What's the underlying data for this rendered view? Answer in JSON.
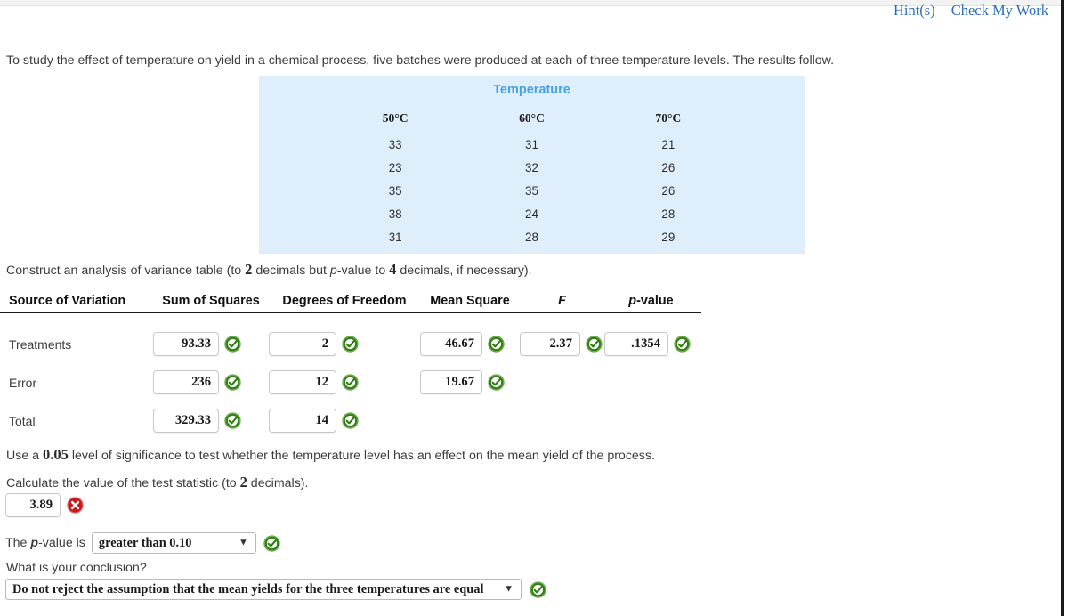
{
  "header": {
    "hint_label": "Hint(s)",
    "check_label": "Check My Work"
  },
  "intro": {
    "text_before": "To study the effect of temperature on yield in a chemical process, five batches were produced at each of three temperature levels. The results follow."
  },
  "data_table": {
    "title": "Temperature",
    "columns": [
      "50°C",
      "60°C",
      "70°C"
    ],
    "rows": [
      [
        "33",
        "31",
        "21"
      ],
      [
        "23",
        "32",
        "26"
      ],
      [
        "35",
        "35",
        "26"
      ],
      [
        "38",
        "24",
        "28"
      ],
      [
        "31",
        "28",
        "29"
      ]
    ]
  },
  "construct_prompt": {
    "part1": "Construct an analysis of variance table (to ",
    "decimals1": "2",
    "part2": " decimals but ",
    "pital": "p",
    "part3": "-value to ",
    "decimals2": "4",
    "part4": " decimals, if necessary)."
  },
  "anova": {
    "headers": {
      "source": "Source of Variation",
      "ss": "Sum of Squares",
      "df": "Degrees of Freedom",
      "ms": "Mean Square",
      "f": "F",
      "p_italic": "p",
      "p_rest": "-value"
    },
    "rows": [
      {
        "label": "Treatments",
        "ss": "93.33",
        "ss_mark": "correct",
        "df": "2",
        "df_mark": "correct",
        "ms": "46.67",
        "ms_mark": "correct",
        "f": "2.37",
        "f_mark": "correct",
        "p": ".1354",
        "p_mark": "correct"
      },
      {
        "label": "Error",
        "ss": "236",
        "ss_mark": "correct",
        "df": "12",
        "df_mark": "correct",
        "ms": "19.67",
        "ms_mark": "correct",
        "f": "",
        "f_mark": "none",
        "p": "",
        "p_mark": "none"
      },
      {
        "label": "Total",
        "ss": "329.33",
        "ss_mark": "correct",
        "df": "14",
        "df_mark": "correct",
        "ms": "",
        "ms_mark": "none",
        "f": "",
        "f_mark": "none",
        "p": "",
        "p_mark": "none"
      }
    ]
  },
  "significance": {
    "part1": "Use a ",
    "level": "0.05",
    "part2": " level of significance to test whether the temperature level has an effect on the mean yield of the process."
  },
  "teststat_prompt": {
    "part1": "Calculate the value of the test statistic (to ",
    "decimals": "2",
    "part2": " decimals)."
  },
  "teststat": {
    "value": "3.89",
    "mark": "incorrect"
  },
  "pvalue": {
    "label_before": "The ",
    "label_italic": "p",
    "label_after": "-value is",
    "selected": "greater than 0.10",
    "options": [
      "greater than 0.10"
    ],
    "mark": "correct"
  },
  "conclusion": {
    "prompt": "What is your conclusion?",
    "selected": "Do not reject the assumption that the mean yields for the three temperatures are equal",
    "options": [
      "Do not reject the assumption that the mean yields for the three temperatures are equal"
    ],
    "mark": "correct"
  },
  "icons": {
    "correct": "check-circle-green-icon",
    "incorrect": "x-circle-red-icon",
    "chevron": "chevron-down-icon"
  },
  "colors": {
    "link": "#2a6ebb",
    "table_bg": "#deeefa",
    "table_title": "#4aa3df",
    "correct_green": "#3d9b1f",
    "incorrect_red": "#c9181c",
    "text": "#3c3c3c"
  }
}
